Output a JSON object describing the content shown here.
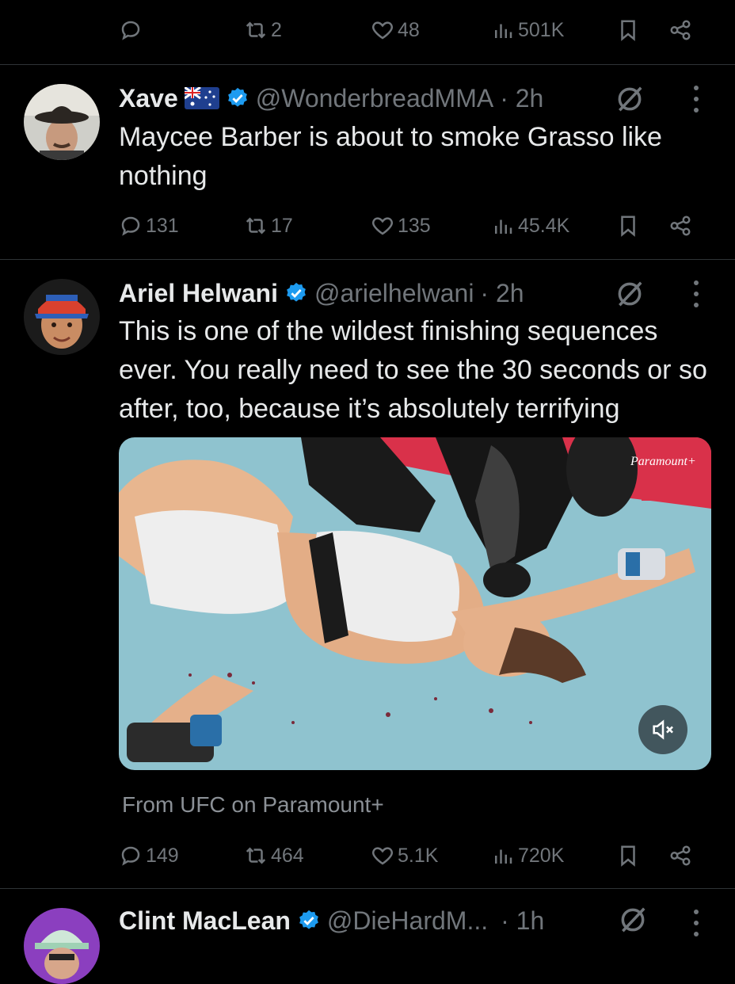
{
  "top_actions": {
    "reply": "",
    "retweet": "2",
    "like": "48",
    "views": "501K"
  },
  "tweets": [
    {
      "name": "Xave",
      "handle": "@WonderbreadMMA",
      "time": "· 2h",
      "text": "Maycee Barber is about to smoke Grasso like nothing",
      "reply": "131",
      "retweet": "17",
      "like": "135",
      "views": "45.4K"
    },
    {
      "name": "Ariel Helwani",
      "handle": "@arielhelwani",
      "time": "· 2h",
      "text": "This is one of the wildest finishing sequences ever. You really need to see the 30 seconds or so after, too, because it’s absolutely terrifying",
      "media_watermark": "Paramount+",
      "media_source": "From UFC on Paramount+",
      "reply": "149",
      "retweet": "464",
      "like": "5.1K",
      "views": "720K"
    },
    {
      "name": "Clint MacLean",
      "handle": "@DieHardM...",
      "time": "· 1h"
    }
  ],
  "icons": {
    "reply": "reply-icon",
    "retweet": "retweet-icon",
    "like": "heart-icon",
    "views": "views-icon",
    "bookmark": "bookmark-icon",
    "share": "share-icon",
    "verified": "verified-badge-icon",
    "grok": "grok-icon",
    "more": "more-icon",
    "mute": "mute-icon",
    "flag": "australia-flag-icon"
  },
  "colors": {
    "background": "#000000",
    "text": "#e7e9ea",
    "muted": "#71767b",
    "verified": "#1d9bf0",
    "divider": "#2f3336"
  }
}
